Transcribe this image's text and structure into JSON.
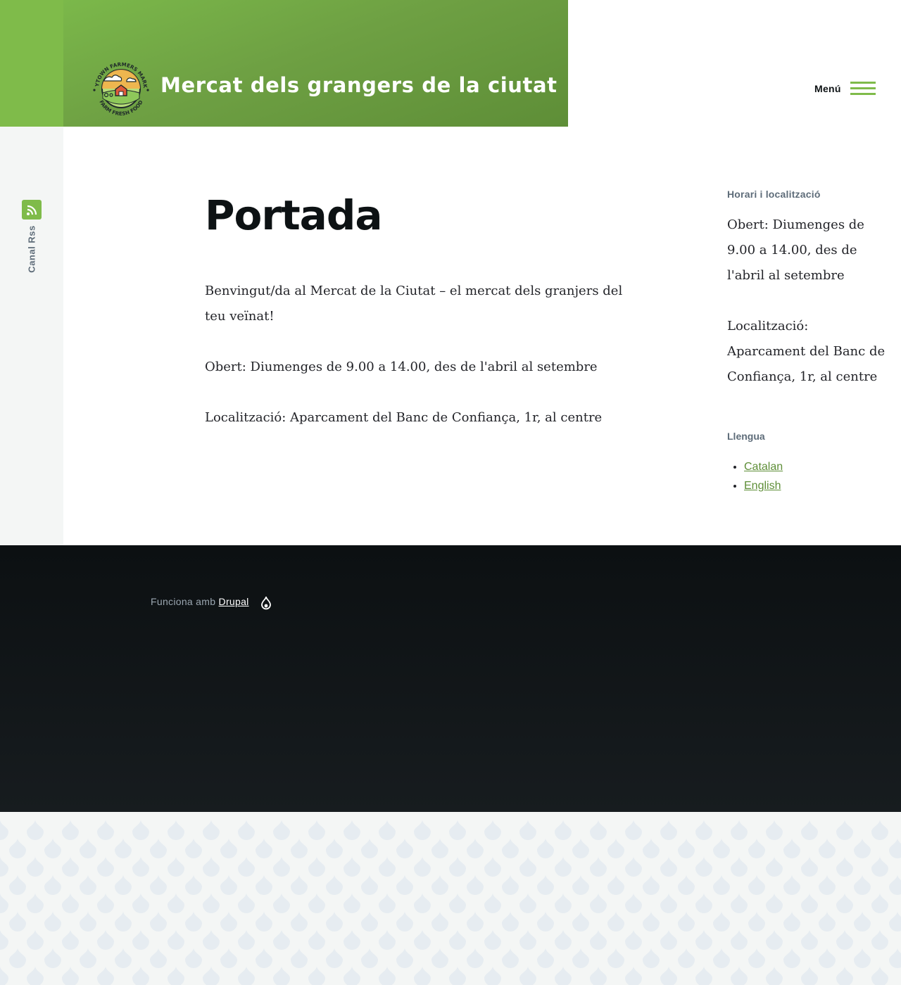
{
  "header": {
    "site_name": "Mercat dels grangers de la ciutat",
    "logo_text_top": "ANYTOWN FARMERS MARKET",
    "logo_text_bottom": "FARM FRESH FOOD",
    "menu_label": "Menú",
    "brand_color": "#7fbb4a"
  },
  "social": {
    "rss_label": "Canal Rss",
    "icon": "rss-icon"
  },
  "main": {
    "title": "Portada",
    "paragraphs": [
      "Benvingut/da al Mercat de la Ciutat – el mercat dels granjers del teu veïnat!",
      "Obert: Diumenges de 9.00 a 14.00, des de l'abril al setembre",
      "Localització: Aparcament del Banc de Confiança, 1r, al centre"
    ]
  },
  "sidebar": {
    "hours_title": "Horari i localització",
    "hours_paragraphs": [
      "Obert: Diumenges de 9.00 a 14.00, des de l'abril al setembre",
      "Localització: Aparcament del Banc de Confiança, 1r, al centre"
    ],
    "language_title": "Llengua",
    "languages": [
      "Catalan",
      "English"
    ]
  },
  "footer": {
    "powered_prefix": "Funciona amb",
    "powered_link": "Drupal",
    "icon": "drupal-icon"
  }
}
